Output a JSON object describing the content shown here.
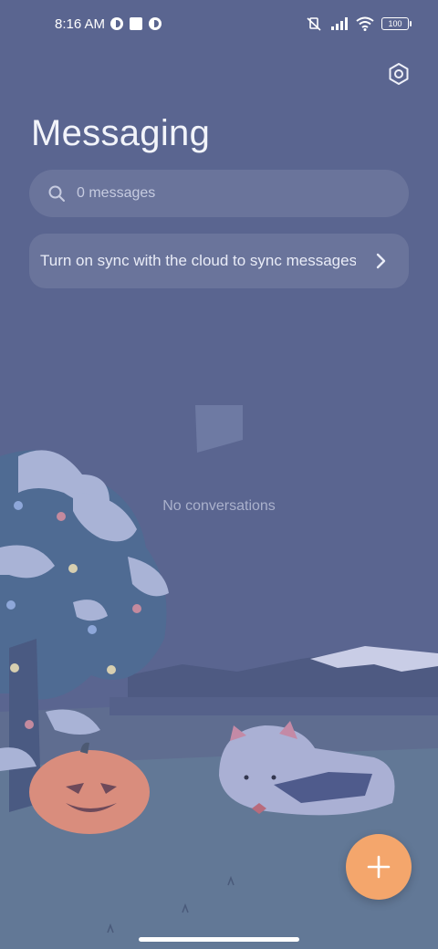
{
  "status_bar": {
    "time": "8:16 AM",
    "battery": "100",
    "icons": [
      "data-saver-icon",
      "square-notification-icon",
      "data-saver-icon",
      "mute-icon",
      "signal-icon",
      "wifi-icon",
      "battery-icon"
    ]
  },
  "header": {
    "title": "Messaging",
    "settings_icon": "settings-hexagon-icon"
  },
  "search": {
    "placeholder": "0 messages",
    "icon": "search-icon"
  },
  "sync_banner": {
    "text": "Turn on sync with the cloud to sync messages",
    "icon": "chevron-right-icon"
  },
  "empty_state": {
    "icon": "chat-bubble-icon",
    "text": "No conversations"
  },
  "fab": {
    "icon": "plus-icon"
  },
  "colors": {
    "background": "#5a6590",
    "accent": "#f4a66c"
  }
}
